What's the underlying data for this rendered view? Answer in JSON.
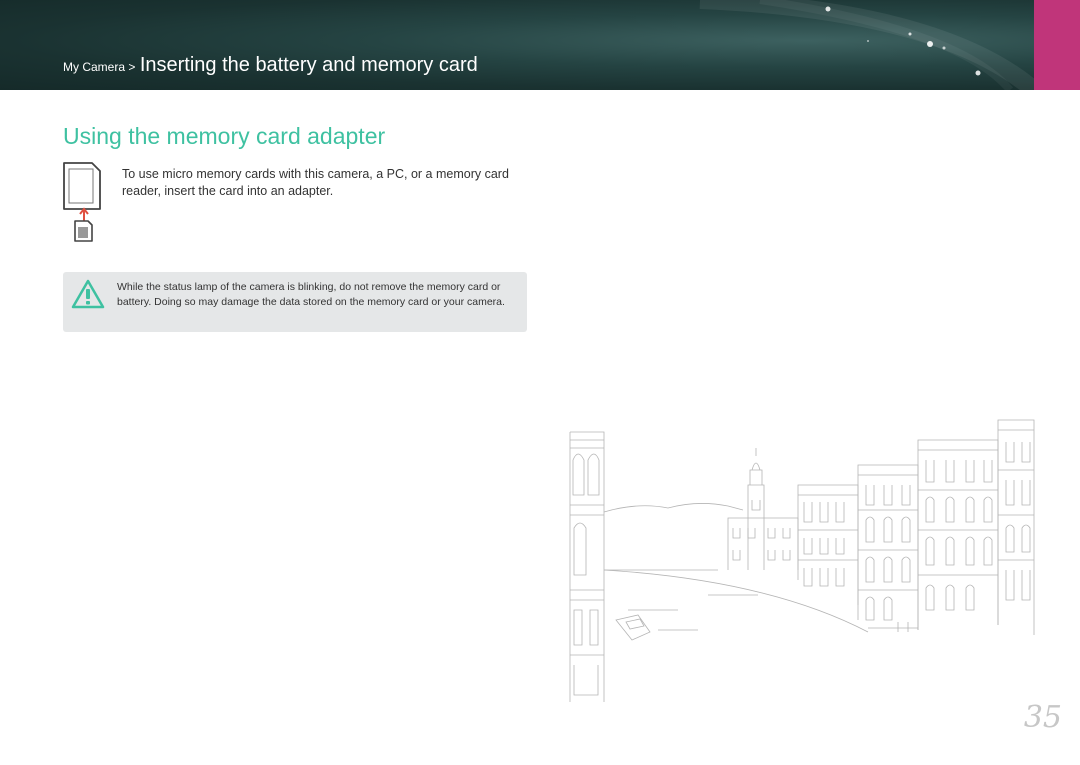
{
  "header": {
    "breadcrumb_parent": "My Camera >",
    "breadcrumb_current": "Inserting the battery and memory card"
  },
  "section": {
    "title": "Using the memory card adapter",
    "body": "To use micro memory cards with this camera, a PC, or a memory card reader, insert the card into an adapter."
  },
  "warning": {
    "text": "While the status lamp of the camera is blinking, do not remove the memory card or battery. Doing so may damage the data stored on the memory card or your camera."
  },
  "page_number": "35",
  "colors": {
    "accent": "#3ec1a1",
    "header_bg": "#1f3b3a",
    "tab": "#c0357a",
    "warning_bg": "#e5e7e8",
    "warning_icon": "#3ec1a1"
  },
  "icons": {
    "adapter": "memory-card-adapter-icon",
    "caution": "warning-triangle-icon"
  }
}
